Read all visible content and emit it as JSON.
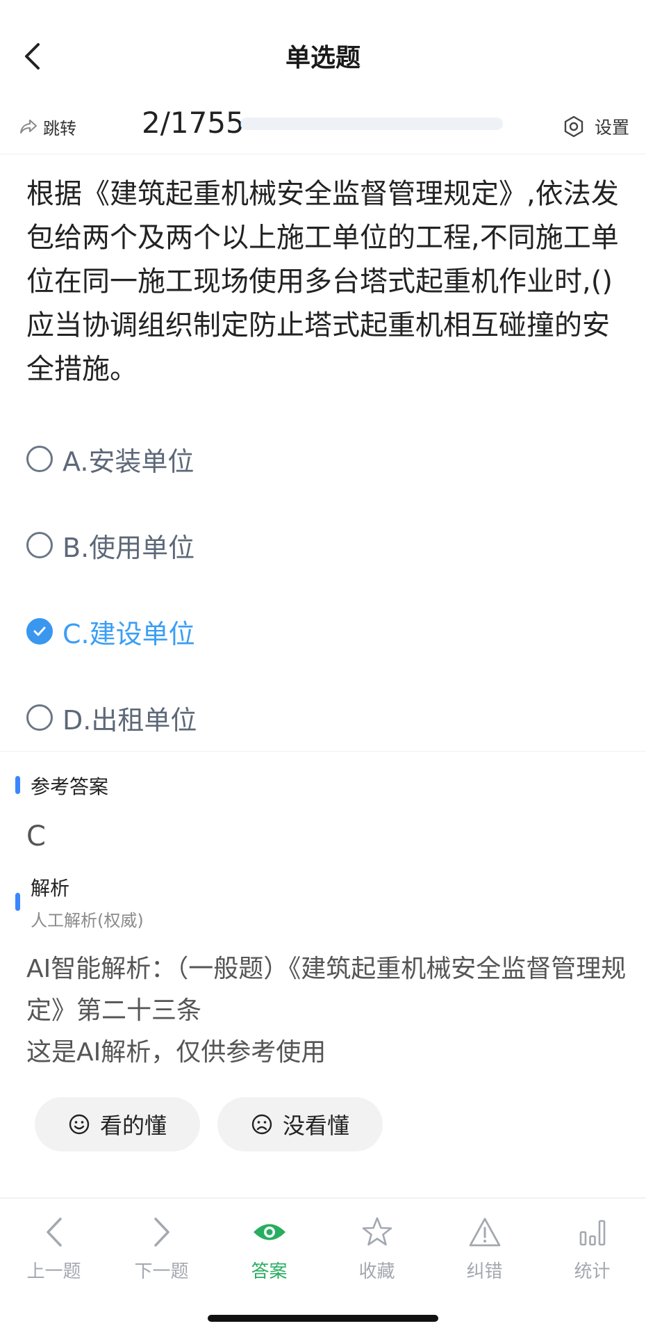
{
  "nav": {
    "title": "单选题"
  },
  "progress": {
    "jump_label": "跳转",
    "text": "2/1755",
    "current": 2,
    "total": 1755,
    "settings_label": "设置"
  },
  "question": {
    "text": "根据《建筑起重机械安全监督管理规定》,依法发包给两个及两个以上施工单位的工程,不同施工单位在同一施工现场使用多台塔式起重机作业时,()应当协调组织制定防止塔式起重机相互碰撞的安全措施。"
  },
  "options": [
    {
      "label": "A.安装单位",
      "selected": false
    },
    {
      "label": "B.使用单位",
      "selected": false
    },
    {
      "label": "C.建设单位",
      "selected": true
    },
    {
      "label": "D.出租单位",
      "selected": false
    }
  ],
  "answer": {
    "title": "参考答案",
    "value": "C"
  },
  "analysis": {
    "title": "解析",
    "subtitle": "人工解析(权威)",
    "line1": "AI智能解析：（一般题）《建筑起重机械安全监督管理规定》第二十三条",
    "line2": "这是AI解析，仅供参考使用"
  },
  "feedback": {
    "understood": "看的懂",
    "not_understood": "没看懂"
  },
  "tabs": [
    {
      "label": "上一题",
      "icon": "chevron-left-icon"
    },
    {
      "label": "下一题",
      "icon": "chevron-right-icon"
    },
    {
      "label": "答案",
      "icon": "eye-icon",
      "active": true
    },
    {
      "label": "收藏",
      "icon": "star-icon"
    },
    {
      "label": "纠错",
      "icon": "warning-icon"
    },
    {
      "label": "统计",
      "icon": "bar-chart-icon"
    }
  ],
  "colors": {
    "accent": "#3a86ff",
    "selected": "#3a9ef5",
    "active_tab": "#27ae60"
  }
}
